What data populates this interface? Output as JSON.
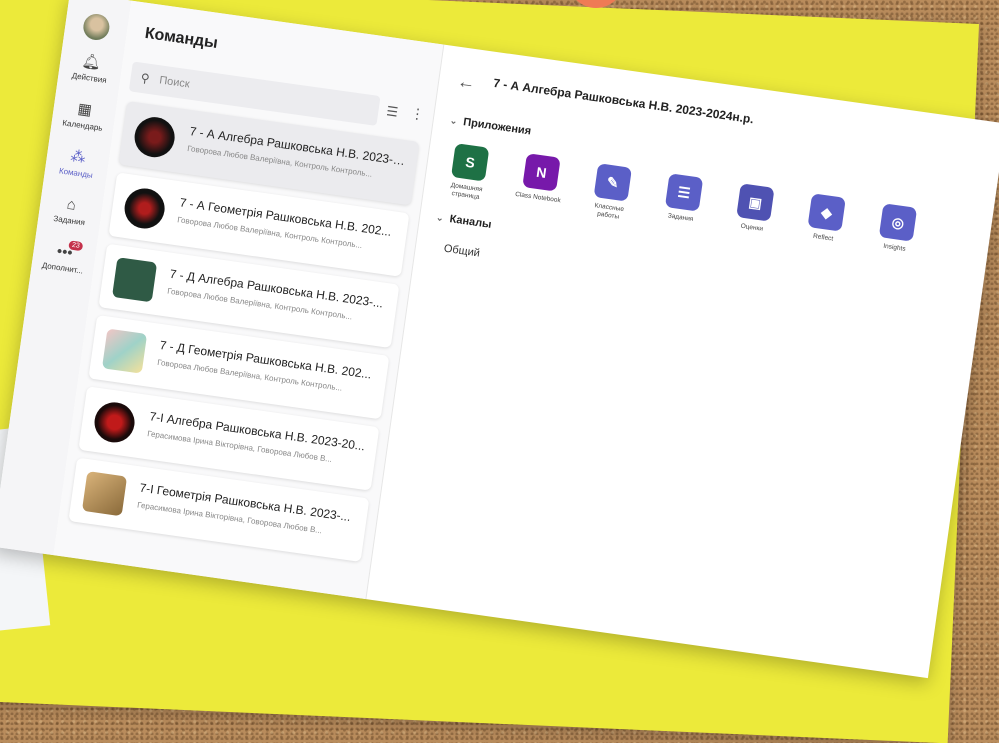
{
  "rail": {
    "items": [
      {
        "label": "Действия",
        "icon": "bell-icon"
      },
      {
        "label": "Календарь",
        "icon": "calendar-icon"
      },
      {
        "label": "Команды",
        "icon": "teams-icon"
      },
      {
        "label": "Задания",
        "icon": "assignments-icon"
      },
      {
        "label": "Дополнит...",
        "icon": "more-apps-icon",
        "badge": "23"
      }
    ]
  },
  "teams": {
    "title": "Команды",
    "search_placeholder": "Поиск",
    "items": [
      {
        "name": "7 - А Алгебра Рашковська Н.В. 2023-2...",
        "members": "Говорова Любов Валеріївна, Контроль Контроль..."
      },
      {
        "name": "7 - А Геометрія Рашковська Н.В. 202...",
        "members": "Говорова Любов Валеріївна, Контроль Контроль..."
      },
      {
        "name": "7 - Д Алгебра Рашковська Н.В. 2023-...",
        "members": "Говорова Любов Валеріївна, Контроль Контроль..."
      },
      {
        "name": "7 - Д Геометрія Рашковська Н.В. 202...",
        "members": "Говорова Любов Валеріївна, Контроль Контроль..."
      },
      {
        "name": "7-І Алгебра Рашковська Н.В. 2023-20...",
        "members": "Герасимова Ірина Вікторівна, Говорова Любов В..."
      },
      {
        "name": "7-І Геометрія Рашковська Н.В. 2023-...",
        "members": "Герасимова Ірина Вікторівна, Говорова Любов В..."
      }
    ]
  },
  "detail": {
    "title": "7 - А Алгебра Рашковська Н.В. 2023-2024н.р.",
    "apps_label": "Приложения",
    "channels_label": "Каналы",
    "general": "Общий",
    "apps": [
      {
        "label": "Домашняя страница",
        "color": "#1e7145",
        "glyph": "S"
      },
      {
        "label": "Class Notebook",
        "color": "#7719aa",
        "glyph": "N"
      },
      {
        "label": "Классные работы",
        "color": "#5b5fc7",
        "glyph": "✎"
      },
      {
        "label": "Задания",
        "color": "#5b5fc7",
        "glyph": "☰"
      },
      {
        "label": "Оценки",
        "color": "#4f52b2",
        "glyph": "▣"
      },
      {
        "label": "Reflect",
        "color": "#5b5fc7",
        "glyph": "◆"
      },
      {
        "label": "Insights",
        "color": "#5b5fc7",
        "glyph": "◎"
      }
    ]
  }
}
